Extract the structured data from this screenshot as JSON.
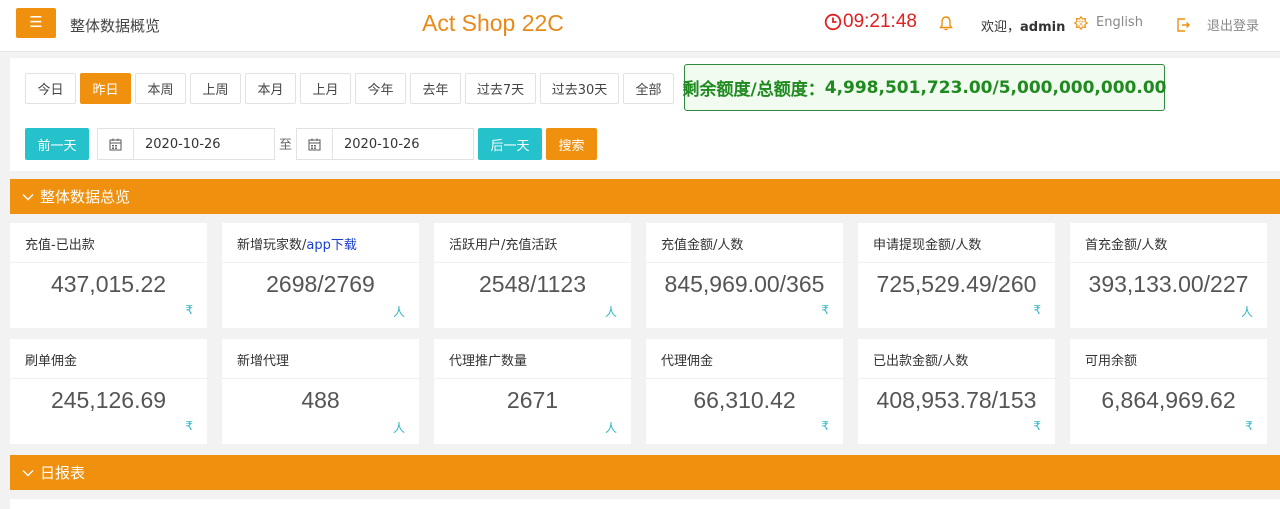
{
  "header": {
    "menu_icon": "☰",
    "page_title": "整体数据概览",
    "app_title": "Act Shop 22C",
    "clock": "09:21:48",
    "welcome_prefix": "欢迎，",
    "username": "admin",
    "language": "English",
    "logout": "退出登录"
  },
  "filters": {
    "ranges": [
      "今日",
      "昨日",
      "本周",
      "上周",
      "本月",
      "上月",
      "今年",
      "去年",
      "过去7天",
      "过去30天",
      "全部"
    ],
    "active_range": "昨日",
    "quota_label": "剩余额度/总额度：",
    "quota_value": "4,998,501,723.00/5,000,000,000.00",
    "prev_day": "前一天",
    "start_date": "2020-10-26",
    "to": "至",
    "end_date": "2020-10-26",
    "next_day": "后一天",
    "search": "搜索"
  },
  "sections": {
    "overview": "整体数据总览",
    "daily": "日报表"
  },
  "stats": [
    {
      "label": "充值-已出款",
      "value": "437,015.22",
      "unit": "₹"
    },
    {
      "label": "新增玩家数/",
      "label_link": "app下载",
      "value": "2698/2769",
      "unit": "人"
    },
    {
      "label": "活跃用户/充值活跃",
      "value": "2548/1123",
      "unit": "人"
    },
    {
      "label": "充值金额/人数",
      "value": "845,969.00/365",
      "unit": "₹"
    },
    {
      "label": "申请提现金额/人数",
      "value": "725,529.49/260",
      "unit": "₹"
    },
    {
      "label": "首充金额/人数",
      "value": "393,133.00/227",
      "unit": "人"
    },
    {
      "label": "刷单佣金",
      "value": "245,126.69",
      "unit": "₹"
    },
    {
      "label": "新增代理",
      "value": "488",
      "unit": "人"
    },
    {
      "label": "代理推广数量",
      "value": "2671",
      "unit": "人"
    },
    {
      "label": "代理佣金",
      "value": "66,310.42",
      "unit": "₹"
    },
    {
      "label": "已出款金额/人数",
      "value": "408,953.78/153",
      "unit": "₹"
    },
    {
      "label": "可用余额",
      "value": "6,864,969.62",
      "unit": "₹"
    }
  ],
  "colors": {
    "accent": "#f0900f",
    "teal": "#26c2cc",
    "quota_green": "#1f8a1f",
    "clock_red": "#e02020"
  }
}
